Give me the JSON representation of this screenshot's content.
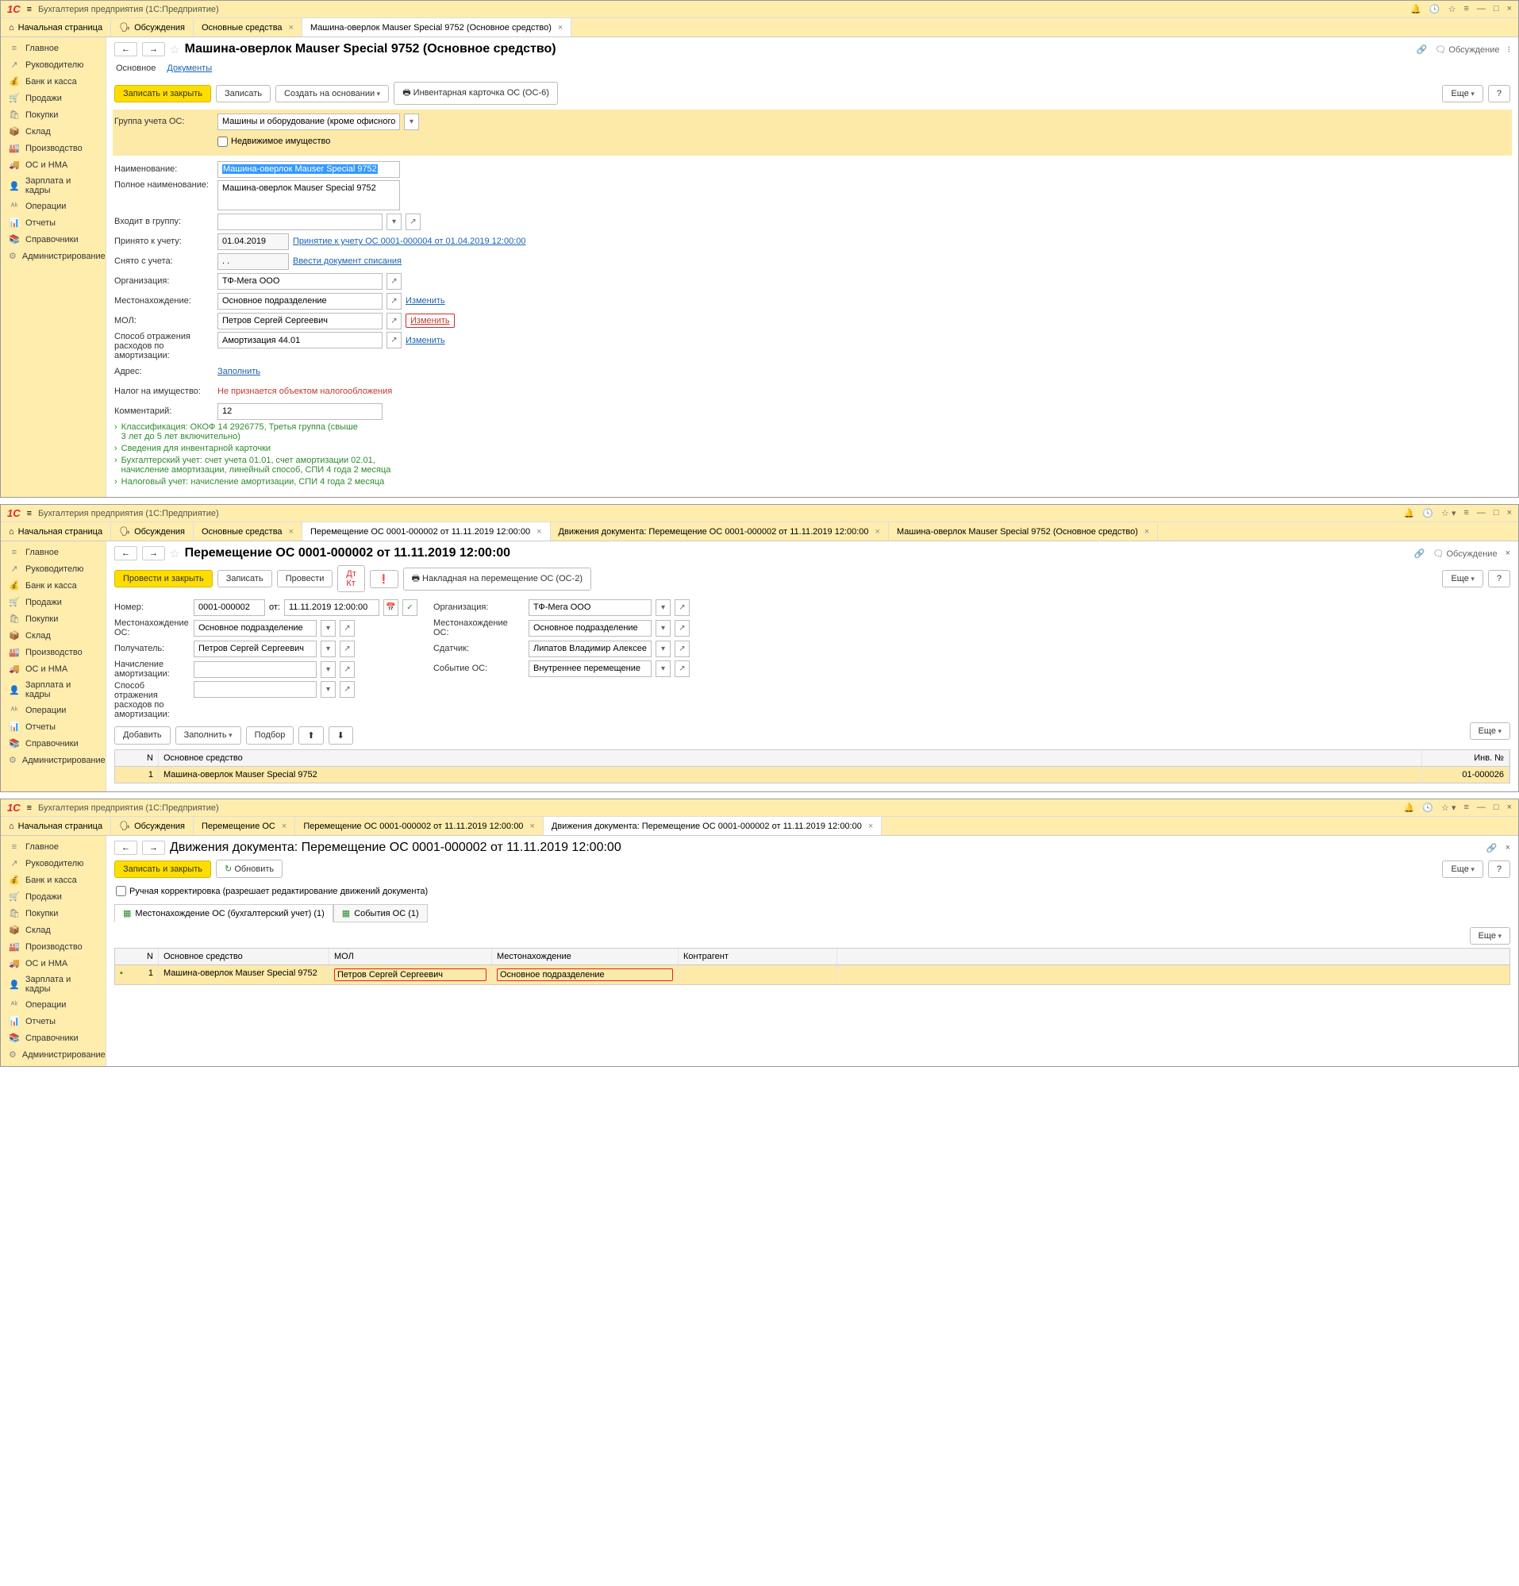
{
  "app_title": "Бухгалтерия предприятия  (1С:Предприятие)",
  "icons": {
    "home": "⌂",
    "disc": "🗣",
    "bell": "🔔",
    "hist": "🕓",
    "star": "☆",
    "dots": "⁝",
    "eq": "≡",
    "min": "—",
    "max": "□",
    "close": "×",
    "back": "←",
    "fwd": "→",
    "print": "🖶",
    "link": "🔗",
    "cal": "📅",
    "refresh": "↻",
    "up": "⬆",
    "down": "⬇",
    "warn": "❗"
  },
  "nav": [
    {
      "ic": "≡",
      "t": "Главное"
    },
    {
      "ic": "↗",
      "t": "Руководителю"
    },
    {
      "ic": "💰",
      "t": "Банк и касса"
    },
    {
      "ic": "🛒",
      "t": "Продажи"
    },
    {
      "ic": "🛍",
      "t": "Покупки"
    },
    {
      "ic": "📦",
      "t": "Склад"
    },
    {
      "ic": "🏭",
      "t": "Производство"
    },
    {
      "ic": "🚚",
      "t": "ОС и НМА"
    },
    {
      "ic": "👤",
      "t": "Зарплата и кадры"
    },
    {
      "ic": "ᴬᵏ",
      "t": "Операции"
    },
    {
      "ic": "📊",
      "t": "Отчеты"
    },
    {
      "ic": "📚",
      "t": "Справочники"
    },
    {
      "ic": "⚙",
      "t": "Администрирование"
    }
  ],
  "p1": {
    "tabs": [
      "Начальная страница",
      "Обсуждения",
      "Основные средства",
      "Машина-оверлок Mauser Special 9752 (Основное средство)"
    ],
    "title": "Машина-оверлок Mauser Special 9752 (Основное средство)",
    "sub": [
      "Основное",
      "Документы"
    ],
    "btns": {
      "save": "Записать и закрыть",
      "write": "Записать",
      "create": "Создать на основании",
      "card": "Инвентарная карточка ОС (ОС-6)",
      "more": "Еще",
      "help": "?",
      "discuss": "Обсуждение"
    },
    "f": {
      "group_l": "Группа учета ОС:",
      "group_v": "Машины и оборудование (кроме офисного)",
      "real_l": "Недвижимое имущество",
      "name_l": "Наименование:",
      "name_v": "Машина-оверлок Mauser Special 9752",
      "full_l": "Полное наименование:",
      "full_v": "Машина-оверлок Mauser Special 9752",
      "grp_l": "Входит в группу:",
      "acc_l": "Принято к учету:",
      "acc_v": "01.04.2019",
      "acc_lnk": "Принятие к учету ОС 0001-000004 от 01.04.2019 12:00:00",
      "off_l": "Снято с учета:",
      "off_v": " .  .",
      "off_lnk": "Ввести документ списания",
      "org_l": "Организация:",
      "org_v": "ТФ-Мега ООО",
      "loc_l": "Местонахождение:",
      "loc_v": "Основное подразделение",
      "chg": "Изменить",
      "mol_l": "МОЛ:",
      "mol_v": "Петров Сергей Сергеевич",
      "amort_l": "Способ отражения расходов по амортизации:",
      "amort_v": "Амортизация 44.01",
      "addr_l": "Адрес:",
      "addr_lnk": "Заполнить",
      "tax_l": "Налог на имущество:",
      "tax_v": "Не признается объектом налогообложения",
      "com_l": "Комментарий:",
      "com_v": "12"
    },
    "exp": [
      "Классификация: ОКОФ 14 2926775, Третья группа (свыше 3 лет до 5 лет включительно)",
      "Сведения для инвентарной карточки",
      "Бухгалтерский учет: счет учета 01.01, счет амортизации 02.01, начисление амортизации, линейный способ, СПИ 4 года 2 месяца",
      "Налоговый учет: начисление амортизации, СПИ 4 года 2 месяца"
    ]
  },
  "p2": {
    "tabs": [
      "Начальная страница",
      "Обсуждения",
      "Основные средства",
      "Перемещение ОС 0001-000002 от 11.11.2019 12:00:00",
      "Движения документа: Перемещение ОС 0001-000002 от 11.11.2019 12:00:00",
      "Машина-оверлок Mauser Special 9752 (Основное средство)"
    ],
    "title": "Перемещение ОС 0001-000002 от 11.11.2019 12:00:00",
    "btns": {
      "post": "Провести и закрыть",
      "write": "Записать",
      "run": "Провести",
      "nak": "Накладная на перемещение ОС (ОС-2)",
      "more": "Еще",
      "help": "?",
      "discuss": "Обсуждение",
      "add": "Добавить",
      "fill": "Заполнить",
      "pick": "Подбор"
    },
    "f": {
      "num_l": "Номер:",
      "num_v": "0001-000002",
      "from": "от:",
      "date_v": "11.11.2019 12:00:00",
      "org_l": "Организация:",
      "org_v": "ТФ-Мега ООО",
      "locos_l": "Местонахождение ОС:",
      "locos_v": "Основное подразделение",
      "recv_l": "Получатель:",
      "recv_v": "Петров Сергей Сергеевич",
      "send_l": "Сдатчик:",
      "send_v": "Липатов Владимир Алексеевич",
      "am_l": "Начисление амортизации:",
      "ev_l": "Событие ОС:",
      "ev_v": "Внутреннее перемещение",
      "way_l": "Способ отражения расходов по амортизации:"
    },
    "grid": {
      "h": [
        "N",
        "Основное средство",
        "Инв. №"
      ],
      "r": [
        "1",
        "Машина-оверлок Mauser Special 9752",
        "01-000026"
      ]
    }
  },
  "p3": {
    "tabs": [
      "Начальная страница",
      "Обсуждения",
      "Перемещение ОС",
      "Перемещение ОС 0001-000002 от 11.11.2019 12:00:00",
      "Движения документа: Перемещение ОС 0001-000002 от 11.11.2019 12:00:00"
    ],
    "title": "Движения документа: Перемещение ОС 0001-000002 от 11.11.2019 12:00:00",
    "btns": {
      "save": "Записать и закрыть",
      "refresh": "Обновить",
      "more": "Еще",
      "help": "?"
    },
    "manual_l": "Ручная корректировка (разрешает редактирование движений документа)",
    "sub": [
      "Местонахождение ОС (бухгалтерский учет) (1)",
      "События ОС (1)"
    ],
    "grid": {
      "h": [
        "N",
        "Основное средство",
        "МОЛ",
        "Местонахождение",
        "Контрагент"
      ],
      "r": [
        "1",
        "Машина-оверлок Mauser Special 9752",
        "Петров Сергей Сергеевич",
        "Основное подразделение",
        ""
      ]
    }
  }
}
